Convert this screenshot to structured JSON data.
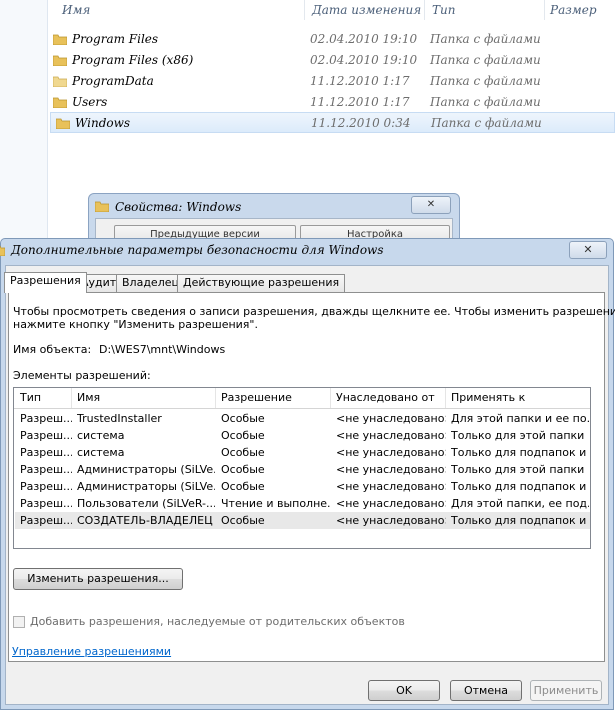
{
  "explorer": {
    "columns": {
      "name": "Имя",
      "date": "Дата изменения",
      "type": "Тип",
      "size": "Размер"
    },
    "rows": [
      {
        "name": "Program Files",
        "date": "02.04.2010 19:10",
        "type": "Папка с файлами"
      },
      {
        "name": "Program Files (x86)",
        "date": "02.04.2010 19:10",
        "type": "Папка с файлами"
      },
      {
        "name": "ProgramData",
        "date": "11.12.2010 1:17",
        "type": "Папка с файлами"
      },
      {
        "name": "Users",
        "date": "11.12.2010 1:17",
        "type": "Папка с файлами"
      },
      {
        "name": "Windows",
        "date": "11.12.2010 0:34",
        "type": "Папка с файлами"
      }
    ]
  },
  "props_dialog": {
    "title": "Свойства: Windows",
    "close": "✕",
    "btn_prev": "Предыдущие версии",
    "btn_settings": "Настройка"
  },
  "dialog": {
    "title": "Дополнительные параметры безопасности для Windows",
    "close": "✕",
    "tabs": [
      "Разрешения",
      "Аудит",
      "Владелец",
      "Действующие разрешения"
    ],
    "intro_line1": "Чтобы просмотреть сведения о записи разрешения, дважды щелкните ее. Чтобы изменить разрешения,",
    "intro_line2": "нажмите кнопку \"Изменить разрешения\".",
    "object_label": "Имя объекта:",
    "object_value": "D:\\WES7\\mnt\\Windows",
    "entries_label": "Элементы разрешений:",
    "list_columns": [
      "Тип",
      "Имя",
      "Разрешение",
      "Унаследовано от",
      "Применять к"
    ],
    "list_rows": [
      [
        "Разреш...",
        "TrustedInstaller",
        "Особые",
        "<не унаследовано>",
        "Для этой папки и ее по..."
      ],
      [
        "Разреш...",
        "система",
        "Особые",
        "<не унаследовано>",
        "Только для этой папки"
      ],
      [
        "Разреш...",
        "система",
        "Особые",
        "<не унаследовано>",
        "Только для подпапок и ..."
      ],
      [
        "Разреш...",
        "Администраторы (SiLVe...",
        "Особые",
        "<не унаследовано>",
        "Только для этой папки"
      ],
      [
        "Разреш...",
        "Администраторы (SiLVe...",
        "Особые",
        "<не унаследовано>",
        "Только для подпапок и ..."
      ],
      [
        "Разреш...",
        "Пользователи (SiLVeR-...",
        "Чтение и выполне...",
        "<не унаследовано>",
        "Для этой папки, ее под..."
      ],
      [
        "Разреш...",
        "СОЗДАТЕЛЬ-ВЛАДЕЛЕЦ",
        "Особые",
        "<не унаследовано>",
        "Только для подпапок и ..."
      ]
    ],
    "change_button": "Изменить разрешения...",
    "inherit_checkbox": "Добавить разрешения, наследуемые от родительских объектов",
    "manage_link": "Управление разрешениями",
    "ok": "OK",
    "cancel": "Отмена",
    "apply": "Применить"
  }
}
